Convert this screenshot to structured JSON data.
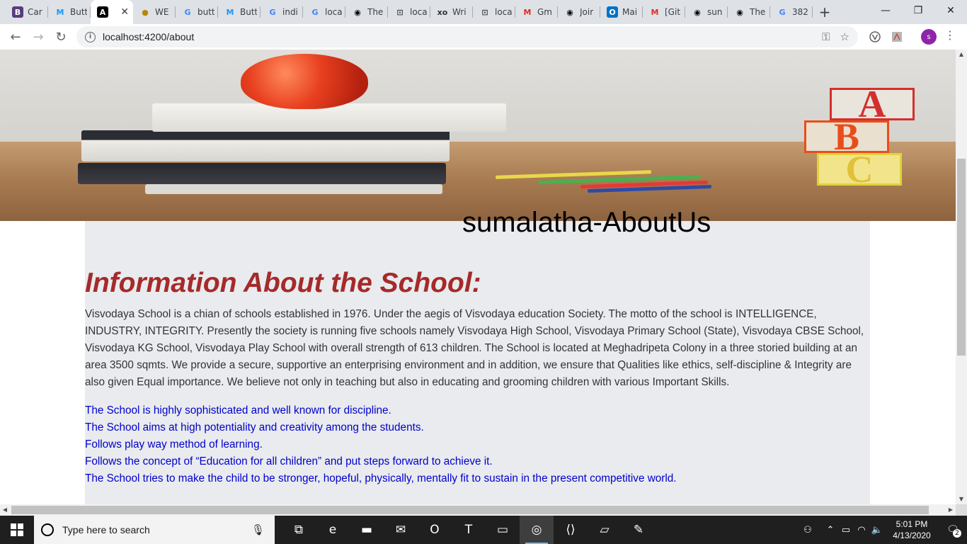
{
  "browser": {
    "tabs": [
      {
        "label": "Car",
        "icon": "bootstrap-icon",
        "fav_text": "B",
        "fav_bg": "#563d7c",
        "fav_color": "#ffffff"
      },
      {
        "label": "Butt",
        "icon": "material-icon",
        "fav_text": "M",
        "fav_bg": "transparent",
        "fav_color": "#2196f3"
      },
      {
        "label": "",
        "icon": "angular-icon",
        "fav_text": "A",
        "fav_bg": "#000000",
        "fav_color": "#ffffff",
        "active": true
      },
      {
        "label": "WE",
        "icon": "school-crest-icon",
        "fav_text": "●",
        "fav_bg": "transparent",
        "fav_color": "#b8860b"
      },
      {
        "label": "butt",
        "icon": "google-icon",
        "fav_text": "G",
        "fav_bg": "transparent",
        "fav_color": "#4285f4"
      },
      {
        "label": "Butt",
        "icon": "material-icon",
        "fav_text": "M",
        "fav_bg": "transparent",
        "fav_color": "#2196f3"
      },
      {
        "label": "indi",
        "icon": "google-icon",
        "fav_text": "G",
        "fav_bg": "transparent",
        "fav_color": "#4285f4"
      },
      {
        "label": "loca",
        "icon": "google-icon",
        "fav_text": "G",
        "fav_bg": "transparent",
        "fav_color": "#4285f4"
      },
      {
        "label": "The",
        "icon": "github-icon",
        "fav_text": "◉",
        "fav_bg": "transparent",
        "fav_color": "#000000"
      },
      {
        "label": "loca",
        "icon": "localhost-icon",
        "fav_text": "⊡",
        "fav_bg": "transparent",
        "fav_color": "#444444"
      },
      {
        "label": "Wri",
        "icon": "xo-icon",
        "fav_text": "xo",
        "fav_bg": "transparent",
        "fav_color": "#333333"
      },
      {
        "label": "loca",
        "icon": "localhost-icon",
        "fav_text": "⊡",
        "fav_bg": "transparent",
        "fav_color": "#444444"
      },
      {
        "label": "Gm",
        "icon": "gmail-icon",
        "fav_text": "M",
        "fav_bg": "transparent",
        "fav_color": "#d93025"
      },
      {
        "label": "Joir",
        "icon": "github-icon",
        "fav_text": "◉",
        "fav_bg": "transparent",
        "fav_color": "#000000"
      },
      {
        "label": "Mai",
        "icon": "outlook-icon",
        "fav_text": "O",
        "fav_bg": "#0072c6",
        "fav_color": "#ffffff"
      },
      {
        "label": "[Git",
        "icon": "gmail-icon",
        "fav_text": "M",
        "fav_bg": "transparent",
        "fav_color": "#d93025"
      },
      {
        "label": "sun",
        "icon": "github-icon",
        "fav_text": "◉",
        "fav_bg": "transparent",
        "fav_color": "#000000"
      },
      {
        "label": "The",
        "icon": "github-icon",
        "fav_text": "◉",
        "fav_bg": "transparent",
        "fav_color": "#000000"
      },
      {
        "label": "382",
        "icon": "google-icon",
        "fav_text": "G",
        "fav_bg": "transparent",
        "fav_color": "#4285f4"
      }
    ],
    "url": "localhost:4200/about",
    "profile_initial": "s"
  },
  "page": {
    "site_title": "sumalatha-AboutUs",
    "heading": "Information About the School:",
    "intro": "Visvodaya School is a chian of schools established in 1976. Under the aegis of Visvodaya education Society. The motto of the school is INTELLIGENCE, INDUSTRY, INTEGRITY. Presently the society is running five schools namely Visvodaya High School, Visvodaya Primary School (State), Visvodaya CBSE School, Visvodaya KG School, Visvodaya Play School with overall strength of 613 children. The School is located at Meghadripeta Colony in a three storied building at an area 3500 sqmts. We provide a secure, supportive an enterprising environment and in addition, we ensure that Qualities like ethics, self-discipline & Integrity are also given Equal importance. We believe not only in teaching but also in educating and grooming children with various Important Skills.",
    "points": [
      "The School is highly sophisticated and well known for discipline.",
      "The School aims at high potentiality and creativity among the students.",
      "Follows play way method of learning.",
      "Follows the concept of “Education for all children” and put steps forward to achieve it.",
      "The School tries to make the child to be stronger, hopeful, physically, mentally fit to sustain in the present competitive world."
    ],
    "hero_blocks": [
      "A",
      "B",
      "C"
    ]
  },
  "taskbar": {
    "search_placeholder": "Type here to search",
    "time": "5:01 PM",
    "date": "4/13/2020",
    "notification_count": "2",
    "apps": [
      {
        "name": "task-view-icon",
        "glyph": "⧉"
      },
      {
        "name": "edge-icon",
        "glyph": "e"
      },
      {
        "name": "file-explorer-icon",
        "glyph": "▬"
      },
      {
        "name": "mail-icon",
        "glyph": "✉"
      },
      {
        "name": "outlook-app-icon",
        "glyph": "O"
      },
      {
        "name": "teams-icon",
        "glyph": "T"
      },
      {
        "name": "terminal-icon",
        "glyph": "▭"
      },
      {
        "name": "chrome-icon",
        "glyph": "◎",
        "active": true
      },
      {
        "name": "vscode-icon",
        "glyph": "⟨⟩"
      },
      {
        "name": "notes-icon",
        "glyph": "▱"
      },
      {
        "name": "paint-icon",
        "glyph": "✎"
      }
    ]
  },
  "colors": {
    "heading": "#a52a2a",
    "points": "#0000cd",
    "content_bg": "#e9ebee"
  }
}
